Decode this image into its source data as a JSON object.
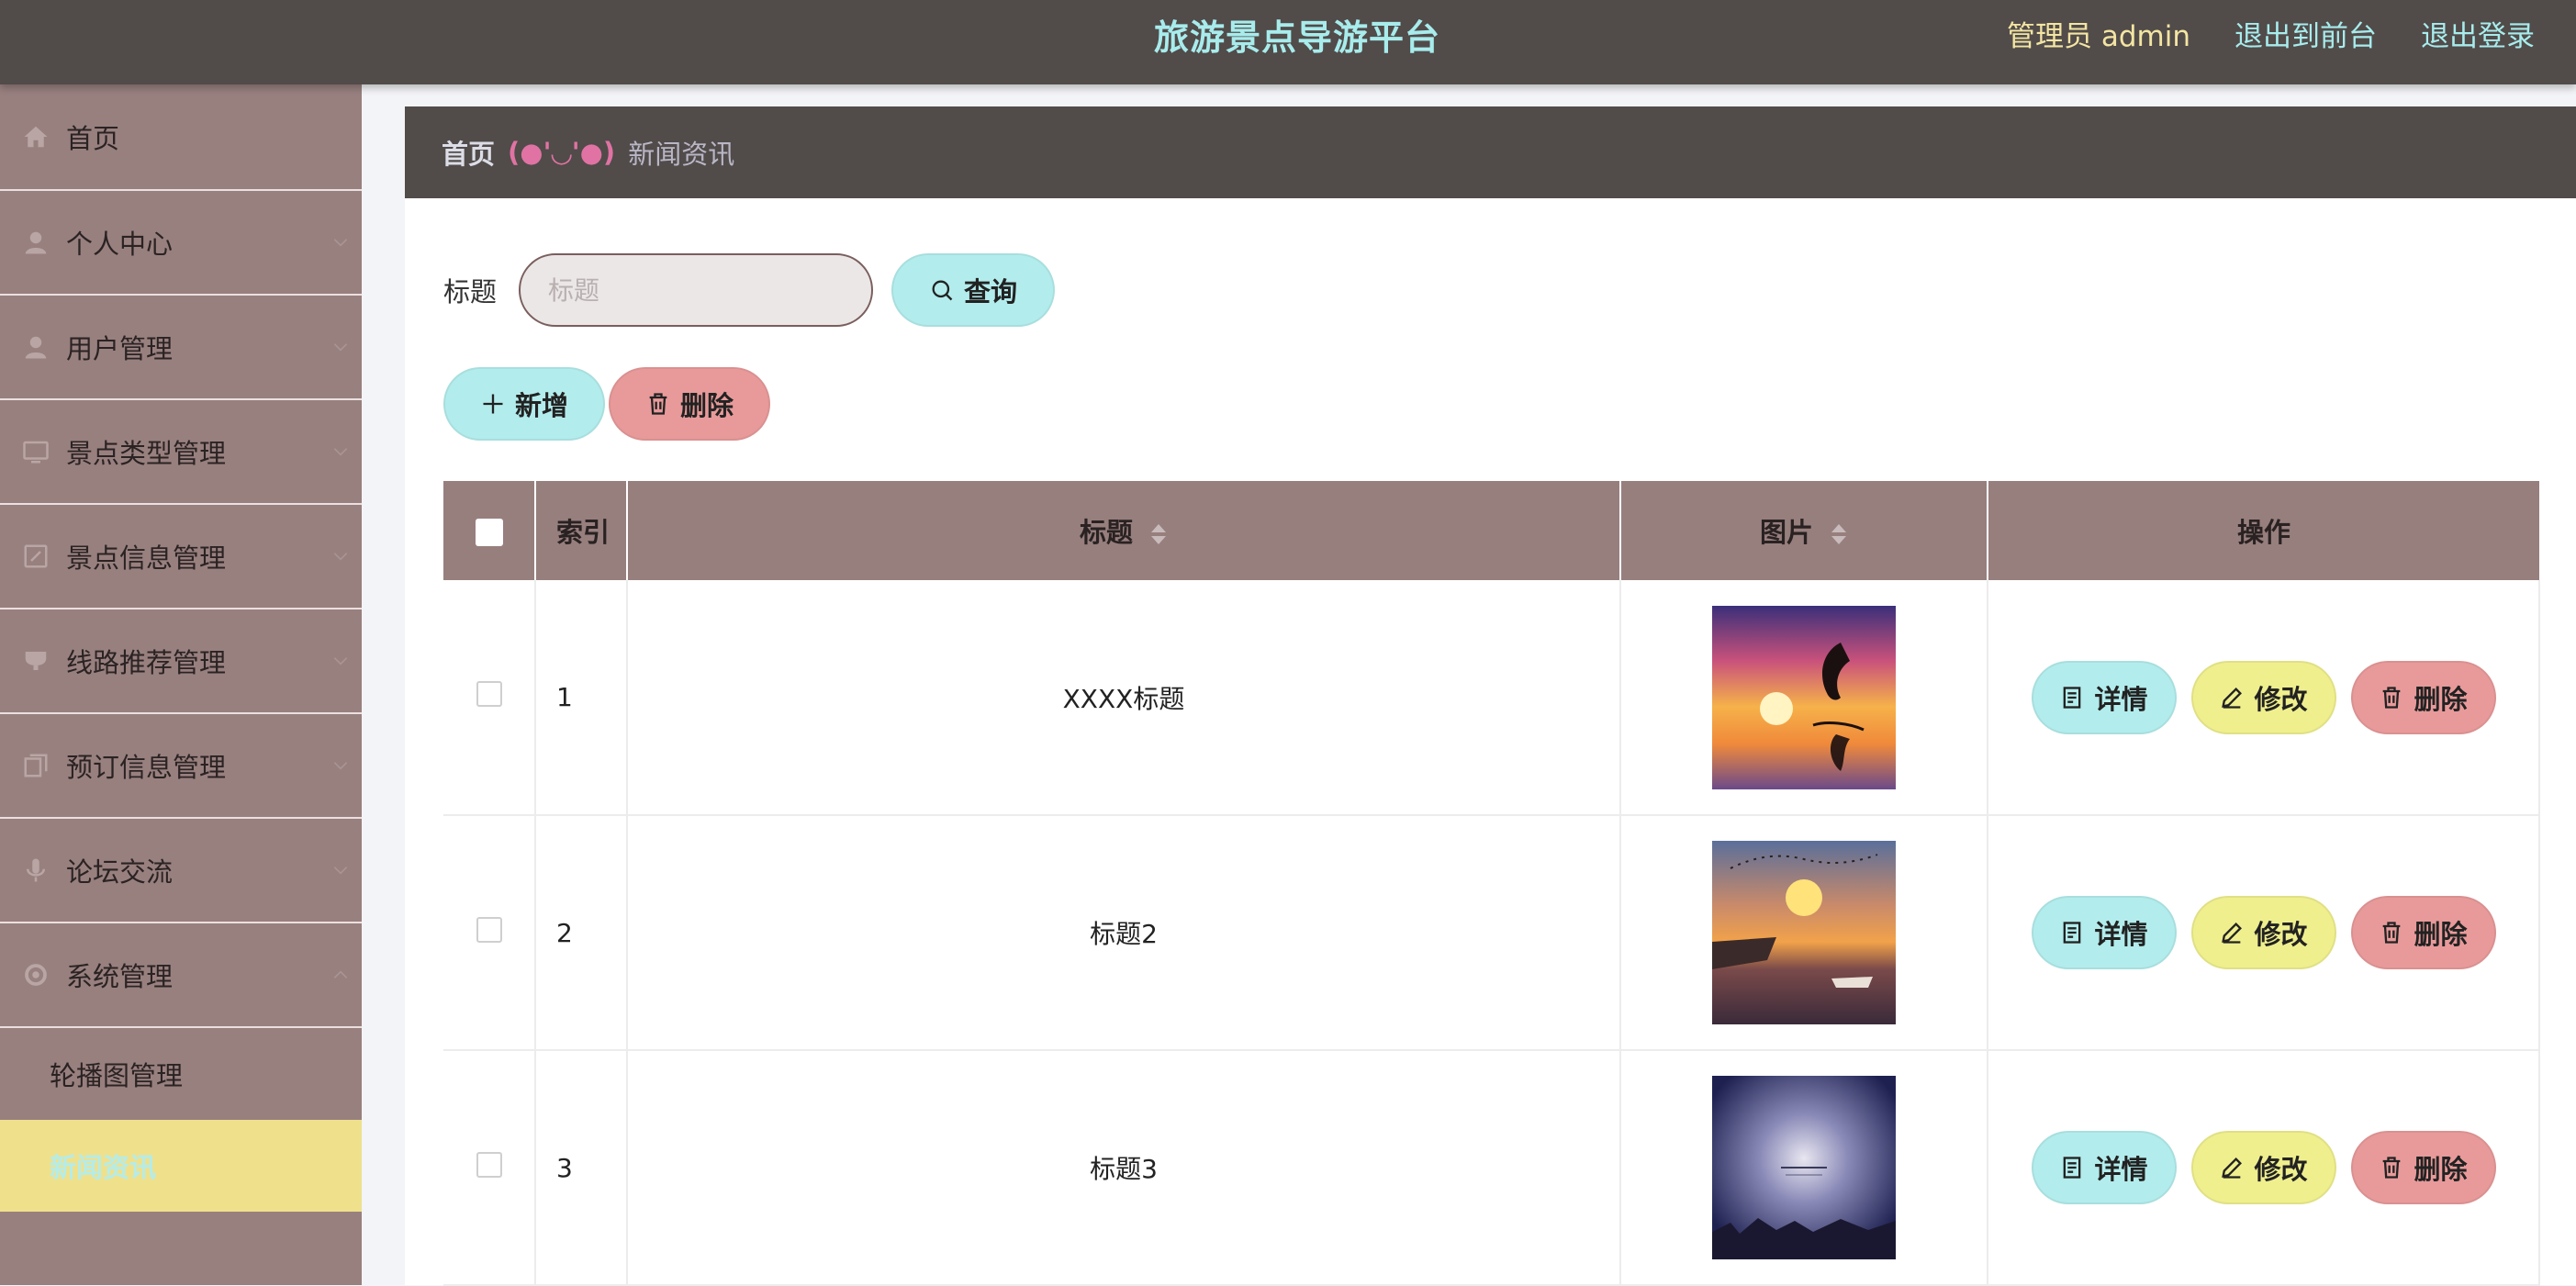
{
  "header": {
    "title": "旅游景点导游平台",
    "user": "管理员 admin",
    "links": [
      "退出到前台",
      "退出登录"
    ]
  },
  "sidebar": {
    "items": [
      {
        "label": "首页",
        "icon": "home-icon"
      },
      {
        "label": "个人中心",
        "icon": "user-icon"
      },
      {
        "label": "用户管理",
        "icon": "user-icon"
      },
      {
        "label": "景点类型管理",
        "icon": "monitor-icon"
      },
      {
        "label": "景点信息管理",
        "icon": "edit-icon"
      },
      {
        "label": "线路推荐管理",
        "icon": "cup-icon"
      },
      {
        "label": "预订信息管理",
        "icon": "copy-icon"
      },
      {
        "label": "论坛交流",
        "icon": "microphone-icon"
      },
      {
        "label": "系统管理",
        "icon": "settings-icon"
      }
    ],
    "submenu": [
      {
        "label": "轮播图管理",
        "active": false
      },
      {
        "label": "新闻资讯",
        "active": true
      }
    ]
  },
  "breadcrumb": {
    "home": "首页",
    "separator": "(●'◡'●)",
    "current": "新闻资讯"
  },
  "search": {
    "label": "标题",
    "placeholder": "标题",
    "button": "查询"
  },
  "actions": {
    "add": "新增",
    "delete": "删除"
  },
  "table": {
    "columns": [
      "索引",
      "标题",
      "图片",
      "操作"
    ],
    "rows": [
      {
        "index": "1",
        "title": "XXXX标题",
        "image": "dolphin-sunset-image"
      },
      {
        "index": "2",
        "title": "标题2",
        "image": "river-sunset-image"
      },
      {
        "index": "3",
        "title": "标题3",
        "image": "night-sky-image"
      }
    ],
    "row_actions": {
      "detail": "详情",
      "edit": "修改",
      "delete": "删除"
    }
  },
  "colors": {
    "header_bg": "#514b4a",
    "sidebar_bg": "#98807f",
    "accent_cyan": "#b3ecec",
    "accent_red": "#e89a9a",
    "accent_yellow": "#efef8e",
    "active_menu": "#efe08c"
  }
}
